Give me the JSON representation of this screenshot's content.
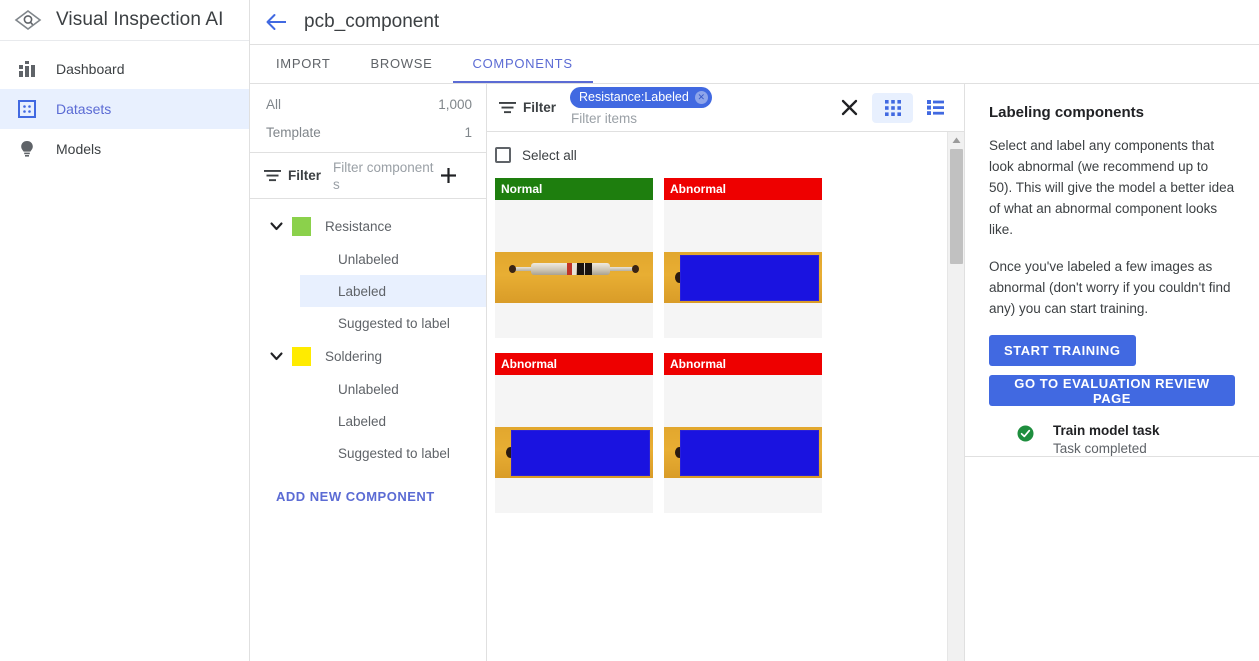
{
  "app": {
    "logo_icon": "visual-inspection-diamond-icon",
    "title": "Visual Inspection AI"
  },
  "sidebar": {
    "items": [
      {
        "label": "Dashboard",
        "icon": "dashboard-icon",
        "active": false
      },
      {
        "label": "Datasets",
        "icon": "datasets-grid-icon",
        "active": true
      },
      {
        "label": "Models",
        "icon": "lightbulb-icon",
        "active": false
      }
    ]
  },
  "header": {
    "back_icon": "back-arrow-icon",
    "title": "pcb_component"
  },
  "tabs": [
    {
      "label": "IMPORT",
      "active": false
    },
    {
      "label": "BROWSE",
      "active": false
    },
    {
      "label": "COMPONENTS",
      "active": true
    }
  ],
  "tree": {
    "counts": [
      {
        "label": "All",
        "value": "1,000"
      },
      {
        "label": "Template",
        "value": "1"
      }
    ],
    "filter": {
      "icon": "filter-icon",
      "label": "Filter",
      "placeholder": "Filter components",
      "value": "",
      "add_icon": "plus-icon"
    },
    "groups": [
      {
        "name": "Resistance",
        "color": "#8bd14b",
        "caret_icon": "chevron-down-icon",
        "expanded": true,
        "children": [
          {
            "label": "Unlabeled",
            "selected": false
          },
          {
            "label": "Labeled",
            "selected": true
          },
          {
            "label": "Suggested to label",
            "selected": false
          }
        ]
      },
      {
        "name": "Soldering",
        "color": "#ffeb00",
        "caret_icon": "chevron-down-icon",
        "expanded": true,
        "children": [
          {
            "label": "Unlabeled",
            "selected": false
          },
          {
            "label": "Labeled",
            "selected": false
          },
          {
            "label": "Suggested to label",
            "selected": false
          }
        ]
      }
    ],
    "add_component_label": "ADD NEW COMPONENT"
  },
  "items_panel": {
    "filter": {
      "icon": "filter-icon",
      "label": "Filter",
      "chip": {
        "text": "Resistance:Labeled",
        "remove_icon": "chip-remove-icon"
      },
      "placeholder": "Filter items",
      "value": "",
      "clear_icon": "close-icon"
    },
    "view_toggle": [
      {
        "icon": "grid-view-icon",
        "active": true
      },
      {
        "icon": "list-view-icon",
        "active": false
      }
    ],
    "select_all": {
      "label": "Select all",
      "checked": false
    },
    "cards": [
      {
        "label": "Normal",
        "status": "normal",
        "border_color": "#1e7e0e",
        "has_bbox": false
      },
      {
        "label": "Abnormal",
        "status": "abnormal",
        "border_color": "#ee0000",
        "has_bbox": true
      },
      {
        "label": "Abnormal",
        "status": "abnormal",
        "border_color": "#ee0000",
        "has_bbox": true
      },
      {
        "label": "Abnormal",
        "status": "abnormal",
        "border_color": "#ee0000",
        "has_bbox": true
      }
    ],
    "scrollbar": {
      "up_arrow_icon": "scroll-up-arrow-icon"
    }
  },
  "help": {
    "title": "Labeling components",
    "paragraph_1": "Select and label any components that look abnormal (we recommend up to 50). This will give the model a better idea of what an abnormal component looks like.",
    "paragraph_2": "Once you've labeled a few images as abnormal (don't worry if you couldn't find any) you can start training.",
    "start_training_label": "START TRAINING",
    "evaluation_label": "GO TO EVALUATION REVIEW PAGE",
    "task": {
      "icon": "check-circle-icon",
      "name": "Train model task",
      "status": "Task completed",
      "status_color": "#1e8e3e"
    }
  },
  "colors": {
    "accent": "#4169e1",
    "nav_active_bg": "#e8f0fe",
    "normal": "#1e7e0e",
    "abnormal": "#ee0000"
  }
}
